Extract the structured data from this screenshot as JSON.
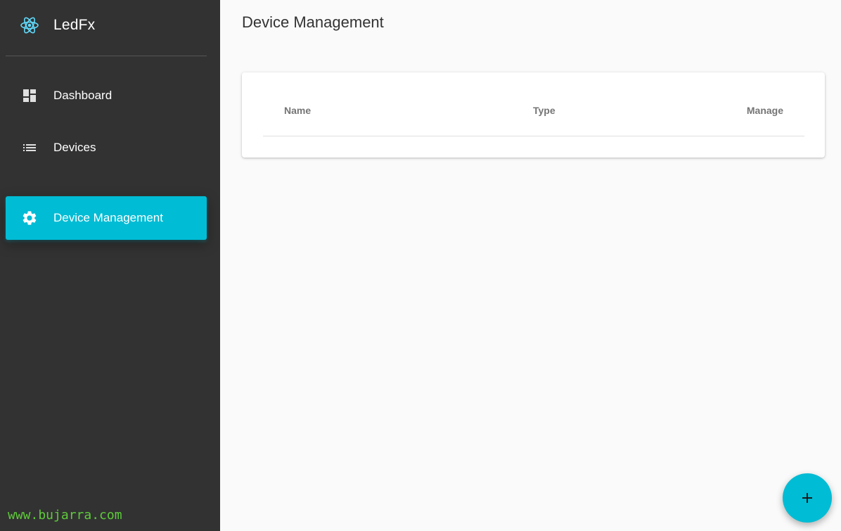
{
  "app": {
    "name": "LedFx"
  },
  "sidebar": {
    "items": [
      {
        "label": "Dashboard",
        "icon": "dashboard-icon"
      },
      {
        "label": "Devices",
        "icon": "list-icon"
      },
      {
        "label": "Device Management",
        "icon": "gear-icon",
        "active": true
      }
    ]
  },
  "main": {
    "title": "Device Management",
    "table": {
      "columns": [
        "Name",
        "Type",
        "Manage"
      ],
      "rows": []
    }
  },
  "fab": {
    "icon": "plus-icon"
  },
  "watermark": "www.bujarra.com",
  "colors": {
    "sidebar_bg": "#323232",
    "accent": "#00bcd4",
    "page_bg": "#fafafa",
    "watermark": "#5ecb3a"
  }
}
